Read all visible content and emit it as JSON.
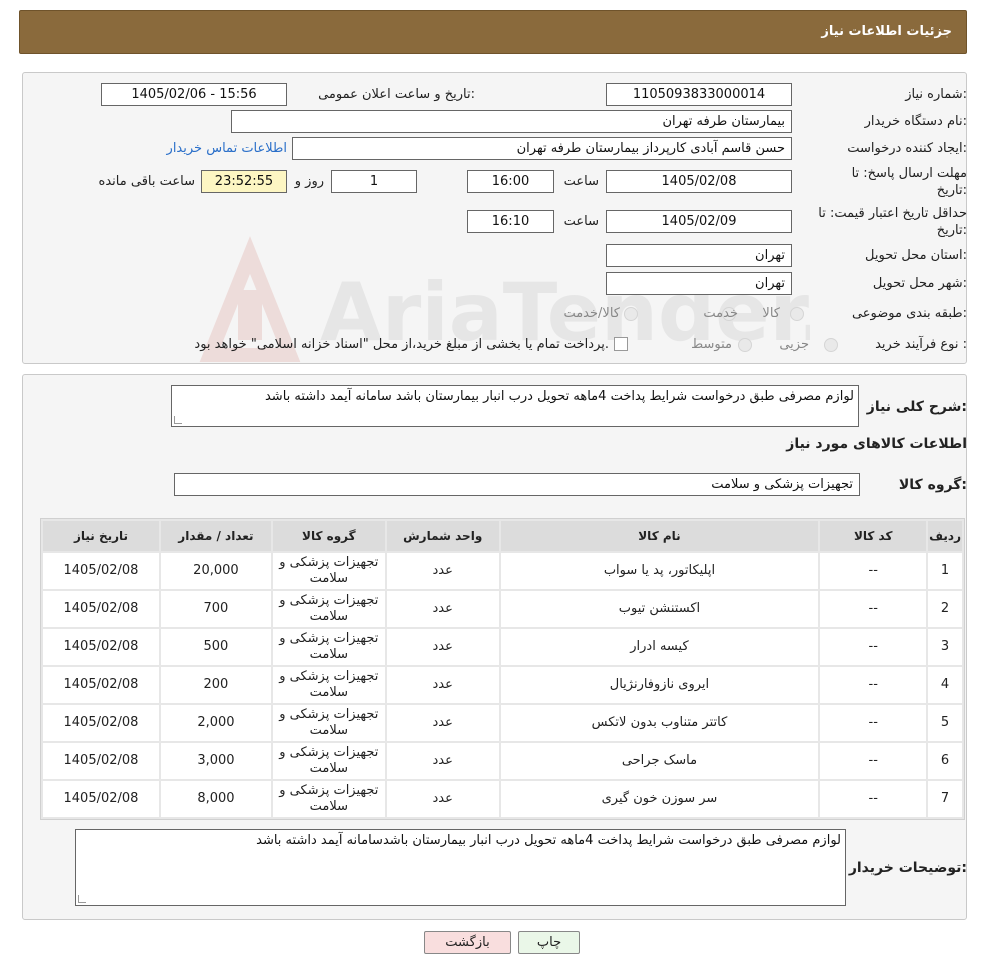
{
  "header": {
    "title": "جزئیات اطلاعات نیاز"
  },
  "form": {
    "need_number_label": "شماره نیاز:",
    "need_number": "1105093833000014",
    "announce_label": "تاریخ و ساعت اعلان عمومی:",
    "announce_value": "1405/02/06 - 15:56",
    "buyer_org_label": "نام دستگاه خریدار:",
    "buyer_org": "بیمارستان طرفه تهران",
    "creator_label": "ایجاد کننده درخواست:",
    "creator": "حسن قاسم آبادی کارپرداز بیمارستان طرفه تهران",
    "contact_link": "اطلاعات تماس خریدار",
    "deadline_label_1": "مهلت ارسال پاسخ: تا",
    "deadline_label_2": "تاریخ:",
    "deadline_date": "1405/02/08",
    "time_label": "ساعت",
    "deadline_time": "16:00",
    "days_value": "1",
    "days_label": "روز و",
    "remaining_time": "23:52:55",
    "remaining_label": "ساعت باقی مانده",
    "validity_label_1": "حداقل تاریخ اعتبار قیمت: تا",
    "validity_label_2": "تاریخ:",
    "validity_date": "1405/02/09",
    "validity_time_label": "ساعت",
    "validity_time": "16:10",
    "province_label": "استان محل تحویل:",
    "province": "تهران",
    "city_label": "شهر محل تحویل:",
    "city": "تهران",
    "category_label": "طبقه بندی موضوعی:",
    "category_options": [
      "کالا",
      "خدمت",
      "کالا/خدمت"
    ],
    "process_label": "نوع فرآیند خرید :",
    "process_options": [
      "جزیی",
      "متوسط"
    ],
    "process_note": "پرداخت تمام یا بخشی از مبلغ خرید،از محل \"اسناد خزانه اسلامی\" خواهد بود."
  },
  "watermark": {
    "text": "AriaTender.neT"
  },
  "details": {
    "summary_label": "شرح کلی نیاز:",
    "summary": "لوازم مصرفی طبق درخواست شرایط پداخت 4ماهه تحویل درب انبار بیمارستان باشد سامانه آیمد داشته باشد",
    "goods_info_title": "اطلاعات کالاهای مورد نیاز",
    "goods_group_label": "گروه کالا:",
    "goods_group": "تجهیزات پزشکی و سلامت",
    "table": {
      "headers": [
        "ردیف",
        "کد کالا",
        "نام کالا",
        "واحد شمارش",
        "گروه کالا",
        "تعداد / مقدار",
        "تاریخ نیاز"
      ],
      "rows": [
        [
          "1",
          "--",
          "اپلیکاتور، پد یا سواب",
          "عدد",
          "تجهیزات پزشکی و سلامت",
          "20,000",
          "1405/02/08"
        ],
        [
          "2",
          "--",
          "اکستنشن تیوب",
          "عدد",
          "تجهیزات پزشکی و سلامت",
          "700",
          "1405/02/08"
        ],
        [
          "3",
          "--",
          "کیسه ادرار",
          "عدد",
          "تجهیزات پزشکی و سلامت",
          "500",
          "1405/02/08"
        ],
        [
          "4",
          "--",
          "ایروی نازوفارنژیال",
          "عدد",
          "تجهیزات پزشکی و سلامت",
          "200",
          "1405/02/08"
        ],
        [
          "5",
          "--",
          "کاتتر متناوب بدون لاتکس",
          "عدد",
          "تجهیزات پزشکی و سلامت",
          "2,000",
          "1405/02/08"
        ],
        [
          "6",
          "--",
          "ماسک جراحی",
          "عدد",
          "تجهیزات پزشکی و سلامت",
          "3,000",
          "1405/02/08"
        ],
        [
          "7",
          "--",
          "سر سوزن خون گیری",
          "عدد",
          "تجهیزات پزشکی و سلامت",
          "8,000",
          "1405/02/08"
        ]
      ]
    },
    "buyer_notes_label": "توضیحات خریدار:",
    "buyer_notes": "لوازم مصرفی طبق درخواست شرایط پداخت 4ماهه تحویل درب انبار بیمارستان باشدسامانه آیمد داشته باشد"
  },
  "buttons": {
    "print": "چاپ",
    "back": "بازگشت"
  },
  "colors": {
    "header_bg": "#8a6a3c",
    "link": "#2a6fc9",
    "back_button_bg": "#f9dede",
    "print_button_bg": "#eaf7e8",
    "remaining_bg": "#fdf6c3"
  }
}
